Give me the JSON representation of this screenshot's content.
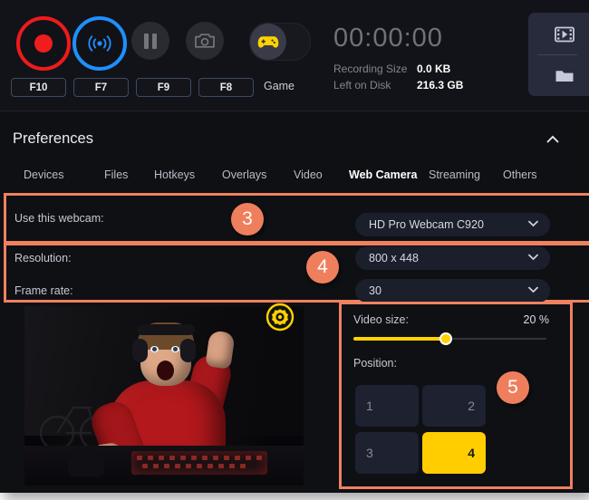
{
  "toolbar": {
    "record": {
      "icon": "record-dot-icon",
      "hotkey": "F10"
    },
    "broadcast": {
      "icon": "broadcast-waves-icon",
      "hotkey": "F7"
    },
    "pause": {
      "icon": "pause-icon",
      "hotkey": "F9"
    },
    "screenshot": {
      "icon": "camera-icon",
      "hotkey": "F8"
    },
    "game_toggle": {
      "icon": "gamepad-icon",
      "label": "Game",
      "state": "off"
    },
    "timer": "00:00:00",
    "stats": [
      {
        "label": "Recording Size",
        "value": "0.0 KB"
      },
      {
        "label": "Left on Disk",
        "value": "216.3 GB"
      }
    ],
    "side_buttons": [
      {
        "icon": "film-strip-icon",
        "name": "open-editor-button"
      },
      {
        "icon": "folder-icon",
        "name": "open-folder-button"
      }
    ]
  },
  "preferences": {
    "title": "Preferences",
    "collapse_icon": "chevron-up-icon",
    "tabs": [
      {
        "label": "Devices",
        "active": false
      },
      {
        "label": "Files",
        "active": false
      },
      {
        "label": "Hotkeys",
        "active": false
      },
      {
        "label": "Overlays",
        "active": false
      },
      {
        "label": "Video",
        "active": false
      },
      {
        "label": "Web Camera",
        "active": true
      },
      {
        "label": "Streaming",
        "active": false
      },
      {
        "label": "Others",
        "active": false
      }
    ]
  },
  "webcam": {
    "use_webcam_label": "Use this webcam:",
    "use_webcam_value": "HD Pro Webcam C920",
    "resolution_label": "Resolution:",
    "resolution_value": "800 x 448",
    "framerate_label": "Frame rate:",
    "framerate_value": "30",
    "settings_icon": "gear-icon",
    "preview_alt": "webcam-preview"
  },
  "video_panel": {
    "video_size_label": "Video size:",
    "video_size_value": "20 %",
    "slider_percent": 48,
    "position_label": "Position:",
    "positions": [
      {
        "label": "1",
        "align": "left",
        "selected": false
      },
      {
        "label": "2",
        "align": "right",
        "selected": false
      },
      {
        "label": "3",
        "align": "left",
        "selected": false
      },
      {
        "label": "4",
        "align": "right",
        "selected": true
      }
    ]
  },
  "callouts": [
    {
      "label": "3"
    },
    {
      "label": "4"
    },
    {
      "label": "5"
    }
  ],
  "colors": {
    "accent_orange": "#ef7f5c",
    "yellow": "#ffd200",
    "record_red": "#ee1b1b",
    "broadcast_blue": "#1e90ff",
    "background": "#0f1014"
  }
}
